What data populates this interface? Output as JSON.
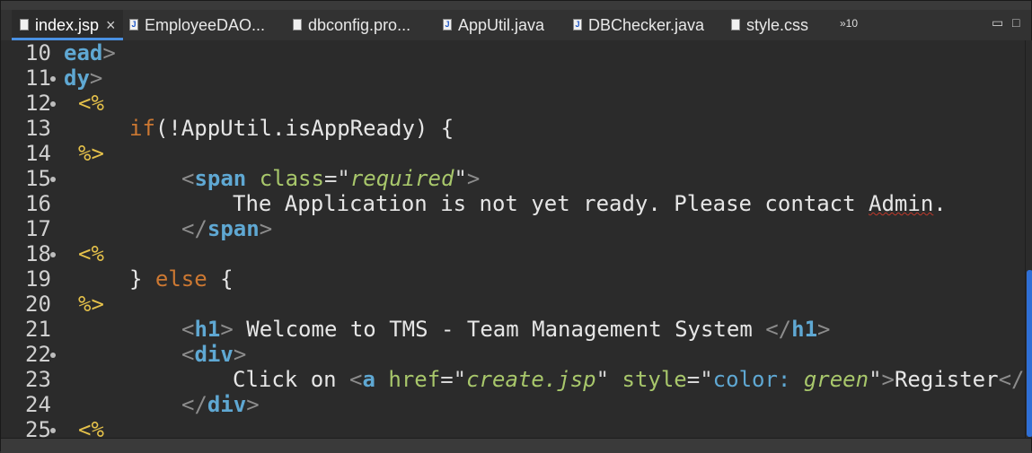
{
  "tabs": [
    {
      "label": "index.jsp",
      "icon": "jsp-file-icon",
      "active": true
    },
    {
      "label": "EmployeeDAO...",
      "icon": "java-file-icon"
    },
    {
      "label": "dbconfig.pro...",
      "icon": "properties-file-icon"
    },
    {
      "label": "AppUtil.java",
      "icon": "java-file-icon"
    },
    {
      "label": "DBChecker.java",
      "icon": "java-file-icon"
    },
    {
      "label": "style.css",
      "icon": "css-file-icon"
    }
  ],
  "tab_close": "×",
  "overflow_label": "»10",
  "window_controls": {
    "minimize": "▭",
    "maximize": "□"
  },
  "editor": {
    "lines": [
      {
        "num": "10",
        "fold": false,
        "tokens": [
          {
            "t": "ead",
            "c": "tag"
          },
          {
            "t": ">",
            "c": "tagbr"
          }
        ]
      },
      {
        "num": "11",
        "fold": true,
        "tokens": [
          {
            "t": "dy",
            "c": "tag"
          },
          {
            "t": ">",
            "c": "tagbr"
          }
        ]
      },
      {
        "num": "12",
        "fold": true,
        "tokens": [
          {
            "t": "<%",
            "c": "scriptlet"
          }
        ]
      },
      {
        "num": "13",
        "fold": false,
        "tokens": [
          {
            "t": "if",
            "c": "kw"
          },
          {
            "t": "(!AppUtil.isAppReady) {",
            "c": "plain"
          }
        ]
      },
      {
        "num": "14",
        "fold": false,
        "tokens": [
          {
            "t": "%>",
            "c": "scriptlet"
          }
        ]
      },
      {
        "num": "15",
        "fold": true,
        "tokens": [
          {
            "t": "<",
            "c": "tagbr"
          },
          {
            "t": "span",
            "c": "tag"
          },
          {
            "t": " class",
            "c": "attr"
          },
          {
            "t": "=\"",
            "c": "strq"
          },
          {
            "t": "required",
            "c": "strv"
          },
          {
            "t": "\"",
            "c": "strq"
          },
          {
            "t": ">",
            "c": "tagbr"
          }
        ]
      },
      {
        "num": "16",
        "fold": false,
        "tokens": [
          {
            "t": "The Application is not yet ready. Please contact ",
            "c": "plain"
          },
          {
            "t": "Admin",
            "c": "squiggle"
          },
          {
            "t": ".",
            "c": "plain"
          }
        ]
      },
      {
        "num": "17",
        "fold": false,
        "tokens": [
          {
            "t": "</",
            "c": "tagbr"
          },
          {
            "t": "span",
            "c": "tag"
          },
          {
            "t": ">",
            "c": "tagbr"
          }
        ]
      },
      {
        "num": "18",
        "fold": true,
        "tokens": [
          {
            "t": "<%",
            "c": "scriptlet"
          }
        ]
      },
      {
        "num": "19",
        "fold": false,
        "tokens": [
          {
            "t": "} ",
            "c": "plain"
          },
          {
            "t": "else",
            "c": "kw"
          },
          {
            "t": " {",
            "c": "plain"
          }
        ]
      },
      {
        "num": "20",
        "fold": false,
        "tokens": [
          {
            "t": "%>",
            "c": "scriptlet"
          }
        ]
      },
      {
        "num": "21",
        "fold": false,
        "tokens": [
          {
            "t": "<",
            "c": "tagbr"
          },
          {
            "t": "h1",
            "c": "tag"
          },
          {
            "t": ">",
            "c": "tagbr"
          },
          {
            "t": " Welcome to TMS - Team Management System ",
            "c": "plain"
          },
          {
            "t": "</",
            "c": "tagbr"
          },
          {
            "t": "h1",
            "c": "tag"
          },
          {
            "t": ">",
            "c": "tagbr"
          }
        ]
      },
      {
        "num": "22",
        "fold": true,
        "tokens": [
          {
            "t": "<",
            "c": "tagbr"
          },
          {
            "t": "div",
            "c": "tag"
          },
          {
            "t": ">",
            "c": "tagbr"
          }
        ]
      },
      {
        "num": "23",
        "fold": false,
        "tokens": [
          {
            "t": "Click on ",
            "c": "plain"
          },
          {
            "t": "<",
            "c": "tagbr"
          },
          {
            "t": "a",
            "c": "tag"
          },
          {
            "t": " href",
            "c": "attr"
          },
          {
            "t": "=\"",
            "c": "strq"
          },
          {
            "t": "create.jsp",
            "c": "strv"
          },
          {
            "t": "\"",
            "c": "strq"
          },
          {
            "t": " style",
            "c": "attr"
          },
          {
            "t": "=\"",
            "c": "strq"
          },
          {
            "t": "color:",
            "c": "cssprop"
          },
          {
            "t": " ",
            "c": "plain"
          },
          {
            "t": "green",
            "c": "strv"
          },
          {
            "t": "\"",
            "c": "strq"
          },
          {
            "t": ">",
            "c": "tagbr"
          },
          {
            "t": "Register",
            "c": "plain"
          },
          {
            "t": "</",
            "c": "tagbr"
          }
        ]
      },
      {
        "num": "24",
        "fold": false,
        "tokens": [
          {
            "t": "</",
            "c": "tagbr"
          },
          {
            "t": "div",
            "c": "tag"
          },
          {
            "t": ">",
            "c": "tagbr"
          }
        ]
      },
      {
        "num": "25",
        "fold": true,
        "tokens": [
          {
            "t": "<%",
            "c": "scriptlet"
          }
        ]
      }
    ]
  },
  "colors": {
    "background": "#2b2b2b",
    "tag": "#5fa8d3",
    "scriptlet": "#e5c14a",
    "keyword": "#cc7832",
    "attribute": "#a8c76b",
    "scroll_thumb": "#2f6fd6"
  }
}
